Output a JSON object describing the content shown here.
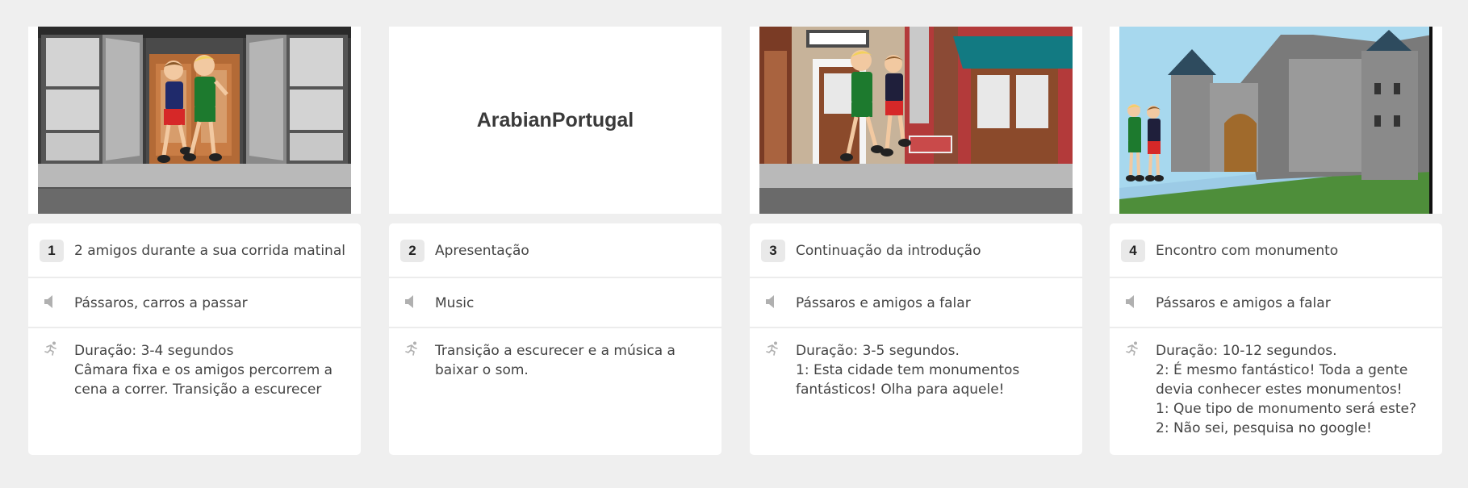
{
  "storyboard": {
    "cells": [
      {
        "number": "1",
        "title": "2 amigos durante a sua corrida matinal",
        "audio": "Pássaros, carros a passar",
        "notes": "Duração: 3-4 segundos\nCâmara fixa e os amigos percorrem a cena a correr. Transição a escurecer",
        "scene": "shop-window-running-friends"
      },
      {
        "number": "2",
        "title": "Apresentação",
        "audio": "Music",
        "notes": "Transição a escurecer e a música a baixar o som.",
        "scene_text": "ArabianPortugal"
      },
      {
        "number": "3",
        "title": "Continuação da introdução",
        "audio": "Pássaros e amigos a falar",
        "notes": "Duração: 3-5 segundos.\n1: Esta cidade tem monumentos fantásticos! Olha para aquele!",
        "scene": "street-running-friends"
      },
      {
        "number": "4",
        "title": "Encontro com monumento",
        "audio": "Pássaros e amigos a falar",
        "notes": "Duração: 10-12 segundos.\n2: É mesmo fantástico! Toda a gente devia conhecer estes monumentos!\n1: Que tipo de monumento será este?\n2: Não sei, pesquisa no google!",
        "scene": "castle-friends"
      }
    ],
    "icons": {
      "audio": "speaker-icon",
      "notes": "running-person-icon"
    }
  }
}
